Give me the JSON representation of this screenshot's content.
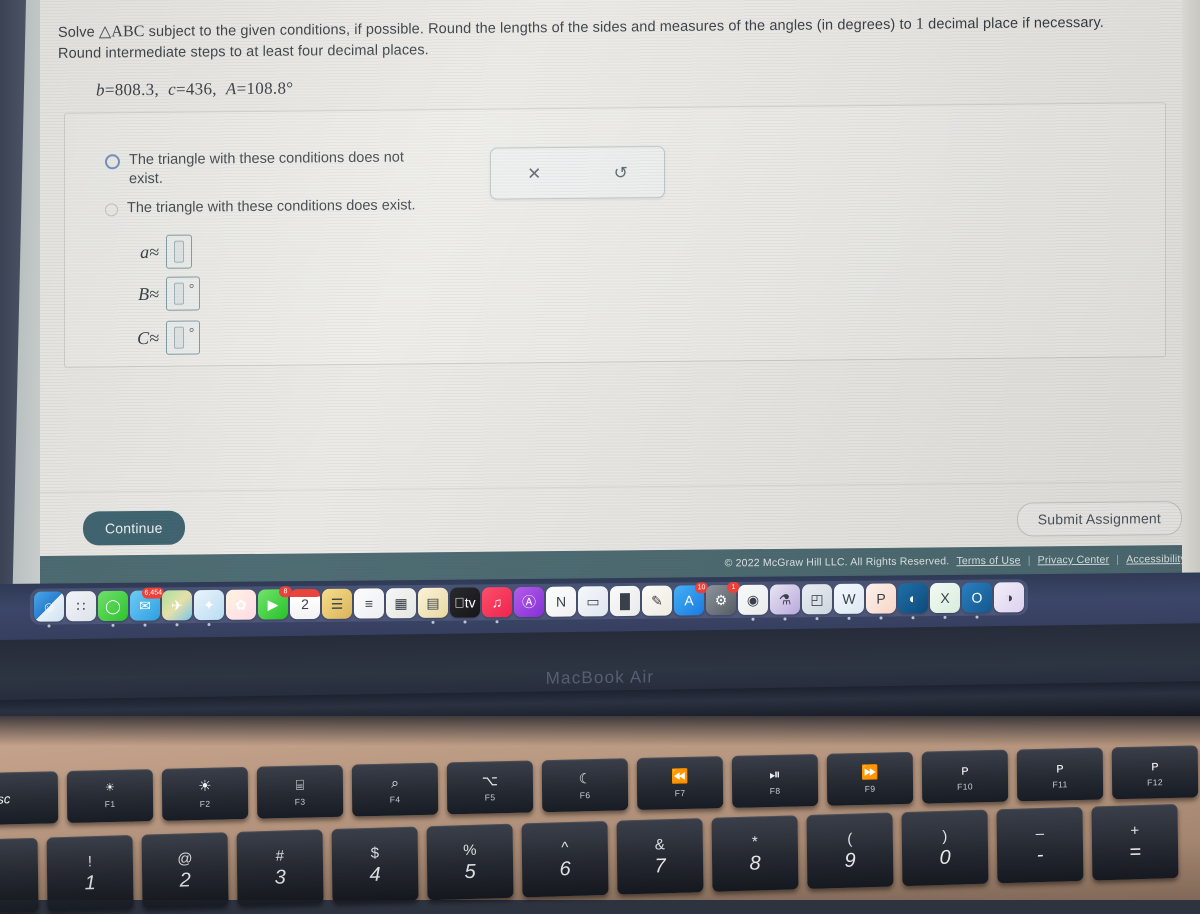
{
  "problem": {
    "prompt_part1": "Solve ",
    "prompt_triangle": "△ABC",
    "prompt_part2": " subject to the given conditions, if possible. Round the lengths of the sides and measures of the angles (in degrees) to ",
    "prompt_precision": "1",
    "prompt_part3": " decimal place if necessary.",
    "prompt_line2": "Round intermediate steps to at least four decimal places.",
    "givens": "b = 808.3,  c = 436,  A = 108.8°",
    "given_b_label": "b",
    "given_b_value": "808.3",
    "given_c_label": "c",
    "given_c_value": "436",
    "given_A_label": "A",
    "given_A_value": "108.8°"
  },
  "options": [
    {
      "label": "The triangle with these conditions does not exist.",
      "selected": false,
      "focused": true
    },
    {
      "label": "The triangle with these conditions does exist.",
      "selected": false,
      "focused": false
    }
  ],
  "answers": [
    {
      "label": "a≈",
      "value": "",
      "degree": false
    },
    {
      "label": "B≈",
      "value": "",
      "degree": true,
      "degree_symbol": "°"
    },
    {
      "label": "C≈",
      "value": "",
      "degree": true,
      "degree_symbol": "°"
    }
  ],
  "mini_toolbar": {
    "clear_icon": "close-icon",
    "clear_glyph": "✕",
    "undo_icon": "undo-icon",
    "undo_glyph": "↺"
  },
  "actions": {
    "continue_label": "Continue",
    "submit_label": "Submit Assignment"
  },
  "footer": {
    "copyright": "© 2022 McGraw Hill LLC. All Rights Reserved.",
    "terms": "Terms of Use",
    "sep1": "|",
    "privacy": "Privacy Center",
    "sep2": "|",
    "accessibility": "Accessibility"
  },
  "colors": {
    "continue_bg": "#3f6470",
    "footer_bg": "#4d6b72",
    "radio_focus": "#6e8ebb",
    "mathbox_border": "#7d9aa2",
    "page_bg": "#eceae6",
    "dock_bg": "#3c4668"
  },
  "laptop": {
    "model_label": "MacBook Air"
  },
  "dock": {
    "items": [
      {
        "name": "finder",
        "glyph": "☺",
        "bg": "linear-gradient(135deg,#4aa8e8 0%,#2a7fd0 50%,#e8f1f8 50%,#cfe2f2 100%)",
        "badge": "",
        "running": true
      },
      {
        "name": "launchpad",
        "glyph": "∷",
        "bg": "linear-gradient(135deg,#f2f4f7 0%,#dde2ea 100%)",
        "badge": "",
        "running": false
      },
      {
        "name": "messages",
        "glyph": "◯",
        "bg": "linear-gradient(135deg,#6fe06c 0%,#2cc32b 100%)",
        "badge": "",
        "running": true
      },
      {
        "name": "mail",
        "glyph": "✉",
        "bg": "linear-gradient(135deg,#6ecbf5 0%,#2f9fe0 100%)",
        "badge": "6,454",
        "running": true
      },
      {
        "name": "maps",
        "glyph": "✈",
        "bg": "linear-gradient(135deg,#a8e0a0 0%,#e6e0a8 50%,#7cc6e8 100%)",
        "badge": "",
        "running": true
      },
      {
        "name": "safari",
        "glyph": "✦",
        "bg": "linear-gradient(135deg,#eaf4fb 0%,#b9dcf2 100%)",
        "badge": "",
        "running": true
      },
      {
        "name": "photos",
        "glyph": "✿",
        "bg": "linear-gradient(135deg,#fff4e0 0%,#ffd9e8 100%)",
        "badge": "",
        "running": false
      },
      {
        "name": "facetime",
        "glyph": "▶",
        "bg": "linear-gradient(135deg,#72e46e 0%,#27c128 100%)",
        "badge": "8",
        "running": false
      },
      {
        "name": "calendar",
        "glyph": "2",
        "bg": "linear-gradient(180deg,#e8433c 0%,#e8433c 26%,#ffffff 26%,#f2f2f2 100%)",
        "badge": "",
        "running": false
      },
      {
        "name": "notes",
        "glyph": "☰",
        "bg": "linear-gradient(135deg,#f7dd8a 0%,#d9b45c 100%)",
        "badge": "",
        "running": false
      },
      {
        "name": "reminders",
        "glyph": "≡",
        "bg": "linear-gradient(135deg,#fdfdfd 0%,#eceef0 100%)",
        "badge": "",
        "running": false
      },
      {
        "name": "numbers",
        "glyph": "▦",
        "bg": "linear-gradient(135deg,#f7f7f5 0%,#e4e6e2 100%)",
        "badge": "",
        "running": false
      },
      {
        "name": "pages",
        "glyph": "▤",
        "bg": "linear-gradient(135deg,#fbf3da 0%,#e8d89f 100%)",
        "badge": "",
        "running": true
      },
      {
        "name": "apple-tv",
        "glyph": "tv",
        "bg": "linear-gradient(135deg,#2a2a2e 0%,#161618 100%)",
        "badge": "",
        "running": true
      },
      {
        "name": "music",
        "glyph": "♫",
        "bg": "linear-gradient(135deg,#fb4f6a 0%,#f0234d 100%)",
        "badge": "",
        "running": true
      },
      {
        "name": "podcasts",
        "glyph": "Ⓐ",
        "bg": "linear-gradient(135deg,#b45ce8 0%,#8430d8 100%)",
        "badge": "",
        "running": false
      },
      {
        "name": "news",
        "glyph": "N",
        "bg": "linear-gradient(135deg,#fdfdfd 0%,#f0f0f0 100%)",
        "badge": "",
        "running": false
      },
      {
        "name": "keynote",
        "glyph": "▭",
        "bg": "linear-gradient(135deg,#f5f8fb 0%,#dfe6ee 100%)",
        "badge": "",
        "running": false
      },
      {
        "name": "numbers-charts",
        "glyph": "█",
        "bg": "linear-gradient(135deg,#fafafa 0%,#eaeaea 100%)",
        "badge": "",
        "running": false
      },
      {
        "name": "pages-pencil",
        "glyph": "✎",
        "bg": "linear-gradient(135deg,#fbfaf5 0%,#efece0 100%)",
        "badge": "",
        "running": false
      },
      {
        "name": "app-store",
        "glyph": "A",
        "bg": "linear-gradient(135deg,#44b0f5 0%,#1a7ae0 100%)",
        "badge": "10",
        "running": false
      },
      {
        "name": "system-settings",
        "glyph": "⚙",
        "bg": "linear-gradient(135deg,#8e949c 0%,#565c64 100%)",
        "badge": "1",
        "running": false
      },
      {
        "name": "chrome",
        "glyph": "◉",
        "bg": "linear-gradient(135deg,#f8f9fa 0%,#e9ebed 100%)",
        "badge": "",
        "running": true
      },
      {
        "name": "photo-booth",
        "glyph": "⚗",
        "bg": "linear-gradient(135deg,#e8e4f2 0%,#b9a8dd 100%)",
        "badge": "",
        "running": true
      },
      {
        "name": "preview",
        "glyph": "◰",
        "bg": "linear-gradient(135deg,#e9eef3 0%,#cdd6de 100%)",
        "badge": "",
        "running": true
      },
      {
        "name": "microsoft-word",
        "glyph": "W",
        "bg": "linear-gradient(135deg,#f4f8fc 0%,#dde8f4 100%)",
        "badge": "",
        "running": true
      },
      {
        "name": "microsoft-powerpoint",
        "glyph": "P",
        "bg": "linear-gradient(135deg,#fdf1ec 0%,#f6d6c6 100%)",
        "badge": "",
        "running": true
      },
      {
        "name": "microsoft-teams",
        "glyph": "◐",
        "bg": "linear-gradient(135deg,#1f6fa8 0%,#0e4a7a 100%)",
        "badge": "",
        "running": true
      },
      {
        "name": "microsoft-excel",
        "glyph": "X",
        "bg": "linear-gradient(135deg,#f3faf4 0%,#d8ecdc 100%)",
        "badge": "",
        "running": true
      },
      {
        "name": "microsoft-outlook",
        "glyph": "O",
        "bg": "linear-gradient(135deg,#2a7fbf 0%,#14588e 100%)",
        "badge": "",
        "running": true
      },
      {
        "name": "trash",
        "glyph": "◑",
        "bg": "linear-gradient(135deg,#f2eef8 0%,#ddd2ee 100%)",
        "badge": "",
        "running": false
      }
    ]
  },
  "keyboard": {
    "function_row": [
      {
        "name": "esc",
        "glyph": "",
        "label": "esc",
        "is_esc": true
      },
      {
        "name": "brightness-down",
        "glyph": "☀",
        "label": "F1"
      },
      {
        "name": "brightness-up",
        "glyph": "☀",
        "label": "F2"
      },
      {
        "name": "mission-control",
        "glyph": "⌸",
        "label": "F3"
      },
      {
        "name": "spotlight-search",
        "glyph": "⌕",
        "label": "F4"
      },
      {
        "name": "dictation",
        "glyph": "⌥",
        "label": "F5"
      },
      {
        "name": "do-not-disturb",
        "glyph": "☾",
        "label": "F6"
      },
      {
        "name": "rewind",
        "glyph": "⏪",
        "label": "F7"
      },
      {
        "name": "play-pause",
        "glyph": "⏯",
        "label": "F8"
      },
      {
        "name": "fast-forward",
        "glyph": "⏩",
        "label": "F9"
      },
      {
        "name": "mute",
        "glyph": "ᴘ",
        "label": "F10"
      },
      {
        "name": "volume-down",
        "glyph": "ᴘ",
        "label": "F11"
      },
      {
        "name": "volume-up",
        "glyph": "ᴘ",
        "label": "F12"
      }
    ],
    "number_row": [
      {
        "name": "tilde",
        "top": "~",
        "bot": "",
        "is_tilde": true
      },
      {
        "name": "key-1",
        "top": "!",
        "bot": "1"
      },
      {
        "name": "key-2",
        "top": "@",
        "bot": "2"
      },
      {
        "name": "key-3",
        "top": "#",
        "bot": "3"
      },
      {
        "name": "key-4",
        "top": "$",
        "bot": "4"
      },
      {
        "name": "key-5",
        "top": "%",
        "bot": "5"
      },
      {
        "name": "key-6",
        "top": "^",
        "bot": "6"
      },
      {
        "name": "key-7",
        "top": "&",
        "bot": "7"
      },
      {
        "name": "key-8",
        "top": "*",
        "bot": "8"
      },
      {
        "name": "key-9",
        "top": "(",
        "bot": "9"
      },
      {
        "name": "key-0",
        "top": ")",
        "bot": "0"
      },
      {
        "name": "key-minus",
        "top": "–",
        "bot": "-"
      },
      {
        "name": "key-equals",
        "top": "+",
        "bot": "="
      }
    ]
  }
}
